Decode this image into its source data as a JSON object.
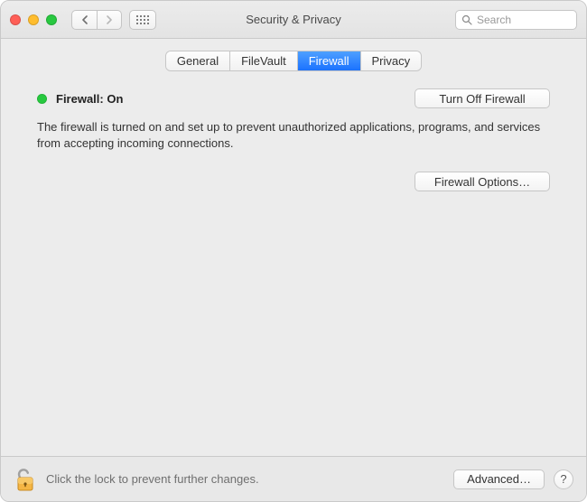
{
  "window": {
    "title": "Security & Privacy"
  },
  "search": {
    "placeholder": "Search",
    "value": ""
  },
  "tabs": [
    {
      "label": "General",
      "active": false
    },
    {
      "label": "FileVault",
      "active": false
    },
    {
      "label": "Firewall",
      "active": true
    },
    {
      "label": "Privacy",
      "active": false
    }
  ],
  "firewall": {
    "status_label": "Firewall: On",
    "status_color": "#27c93f",
    "toggle_button_label": "Turn Off Firewall",
    "description": "The firewall is turned on and set up to prevent unauthorized applications, programs, and services from accepting incoming connections.",
    "options_button_label": "Firewall Options…"
  },
  "footer": {
    "lock_hint": "Click the lock to prevent further changes.",
    "advanced_button_label": "Advanced…",
    "help_label": "?"
  }
}
